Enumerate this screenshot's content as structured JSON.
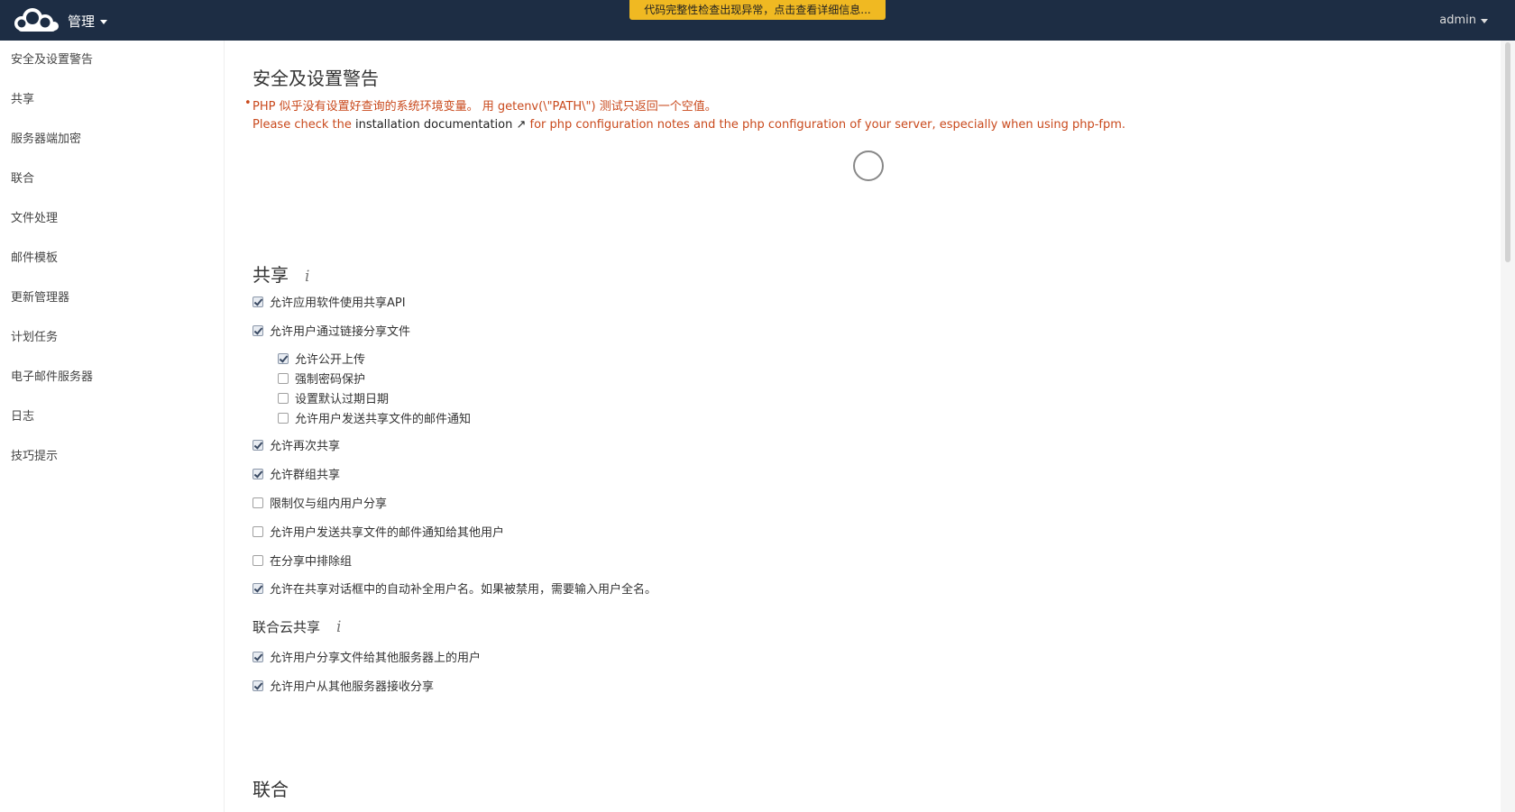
{
  "header": {
    "app_menu_label": "管理",
    "integrity_notice": "代码完整性检查出现异常，点击查看详细信息...",
    "user_label": "admin"
  },
  "sidebar": {
    "items": [
      {
        "label": "安全及设置警告"
      },
      {
        "label": "共享"
      },
      {
        "label": "服务器端加密"
      },
      {
        "label": "联合"
      },
      {
        "label": "文件处理"
      },
      {
        "label": "邮件模板"
      },
      {
        "label": "更新管理器"
      },
      {
        "label": "计划任务"
      },
      {
        "label": "电子邮件服务器"
      },
      {
        "label": "日志"
      },
      {
        "label": "技巧提示"
      }
    ]
  },
  "security": {
    "title": "安全及设置警告",
    "bullet": "•",
    "warning_line1": "PHP 似乎没有设置好查询的系统环境变量。 用 getenv(\\\"PATH\\\") 测试只返回一个空值。",
    "warning_line2_prefix": "Please check the ",
    "doc_link": "installation documentation ↗",
    "warning_line2_suffix": " for php configuration notes and the php configuration of your server, especially when using php-fpm."
  },
  "sharing": {
    "title": "共享",
    "info_icon": "i",
    "options": [
      {
        "label": "允许应用软件使用共享API",
        "checked": true
      },
      {
        "label": "允许用户通过链接分享文件",
        "checked": true
      },
      {
        "label": "允许公开上传",
        "checked": true
      },
      {
        "label": "强制密码保护",
        "checked": false
      },
      {
        "label": "设置默认过期日期",
        "checked": false
      },
      {
        "label": "允许用户发送共享文件的邮件通知",
        "checked": false
      },
      {
        "label": "允许再次共享",
        "checked": true
      },
      {
        "label": "允许群组共享",
        "checked": true
      },
      {
        "label": "限制仅与组内用户分享",
        "checked": false
      },
      {
        "label": "允许用户发送共享文件的邮件通知给其他用户",
        "checked": false
      },
      {
        "label": "在分享中排除组",
        "checked": false
      },
      {
        "label": "允许在共享对话框中的自动补全用户名。如果被禁用，需要输入用户全名。",
        "checked": true
      }
    ]
  },
  "federated_sharing": {
    "title": "联合云共享",
    "info_icon": "i",
    "options": [
      {
        "label": "允许用户分享文件给其他服务器上的用户",
        "checked": true
      },
      {
        "label": "允许用户从其他服务器接收分享",
        "checked": true
      }
    ]
  },
  "federation": {
    "title": "联合"
  }
}
